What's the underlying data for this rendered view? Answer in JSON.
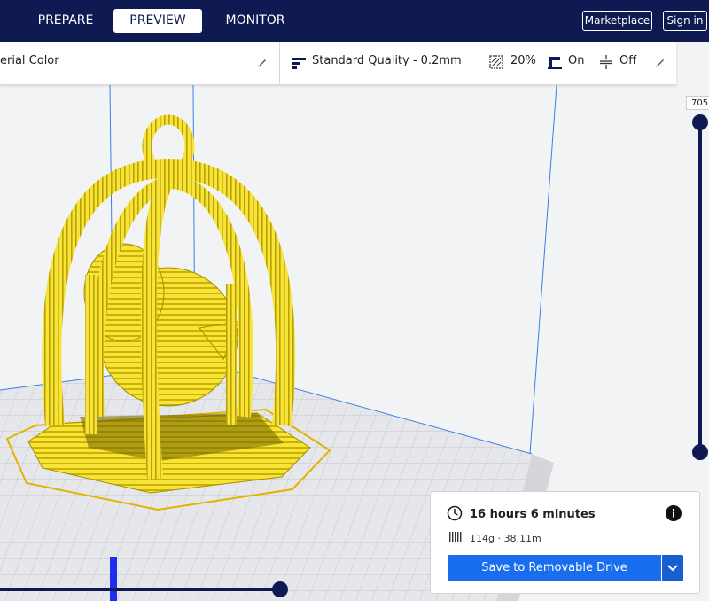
{
  "nav": {
    "tabs": [
      {
        "label": "PREPARE",
        "active": false
      },
      {
        "label": "PREVIEW",
        "active": true
      },
      {
        "label": "MONITOR",
        "active": false
      }
    ],
    "marketplace_label": "Marketplace",
    "signin_label": "Sign in"
  },
  "settings_bar": {
    "material_label": "erial Color",
    "quality_label": "Standard Quality - 0.2mm",
    "infill_value": "20%",
    "support_value": "On",
    "adhesion_value": "Off"
  },
  "layer_slider": {
    "current_layer": "705"
  },
  "print_info": {
    "time": "16 hours 6 minutes",
    "material": "114g · 38.11m",
    "save_label": "Save to Removable Drive"
  },
  "colors": {
    "header_bg": "#0f1a52",
    "accent_blue": "#196ef0",
    "model_yellow": "#f7e33a",
    "model_edge": "#c9b200",
    "slider_dark": "#0f1a52"
  },
  "icons": {
    "edit": "pencil-icon",
    "infill": "infill-icon",
    "support": "support-icon",
    "adhesion": "adhesion-icon",
    "time": "clock-icon",
    "info": "info-icon",
    "material": "spool-icon",
    "dropdown": "chevron-down-icon"
  }
}
